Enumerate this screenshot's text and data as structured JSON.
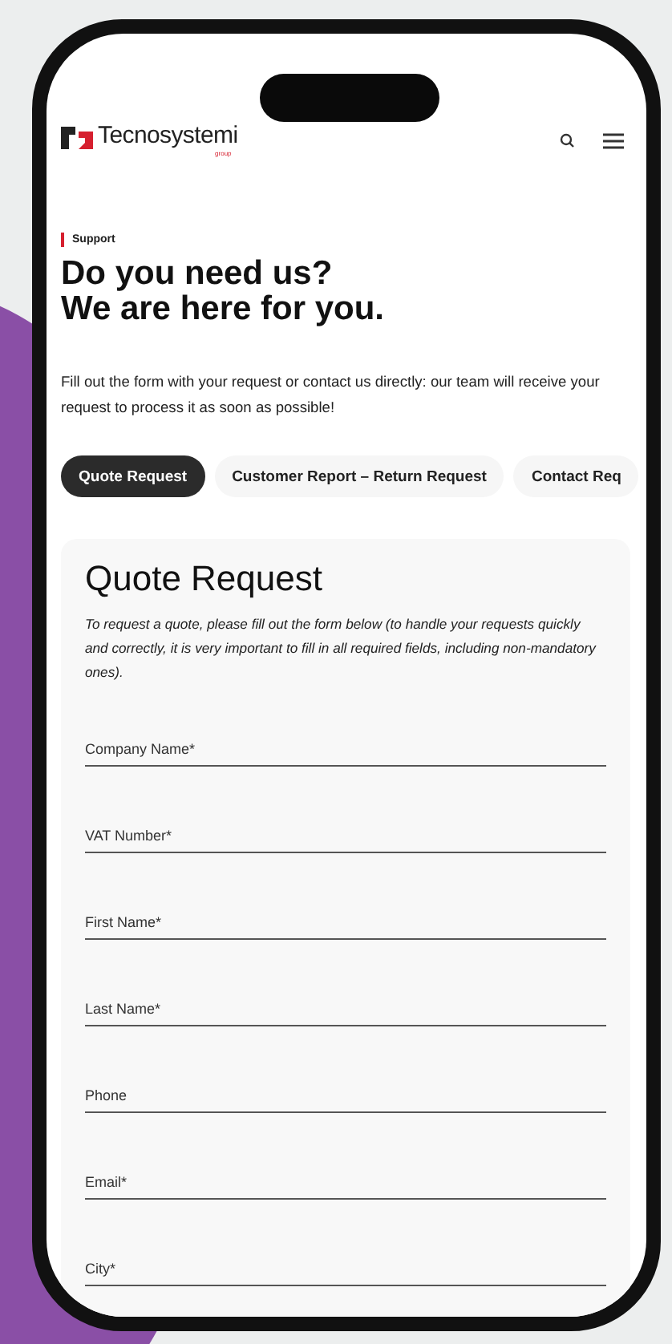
{
  "header": {
    "logo_text": "Tecnosystemi",
    "logo_subtext": "group"
  },
  "eyebrow": "Support",
  "heading_lines": [
    "Do you need us?",
    "We are here for you."
  ],
  "intro": "Fill out the form with your request or contact us directly: our team will receive your request to process it as soon as possible!",
  "tabs": [
    {
      "label": "Quote Request",
      "selected": true
    },
    {
      "label": "Customer Report – Return Request",
      "selected": false
    },
    {
      "label": "Contact Req",
      "selected": false
    }
  ],
  "form": {
    "title": "Quote Request",
    "description": "To request a quote, please fill out the form below (to handle your requests quickly and correctly, it is very important to fill in all required fields, including non-mandatory ones).",
    "fields": [
      {
        "placeholder": "Company Name*"
      },
      {
        "placeholder": "VAT Number*"
      },
      {
        "placeholder": "First Name*"
      },
      {
        "placeholder": "Last Name*"
      },
      {
        "placeholder": "Phone"
      },
      {
        "placeholder": "Email*"
      },
      {
        "placeholder": "City*"
      }
    ]
  }
}
